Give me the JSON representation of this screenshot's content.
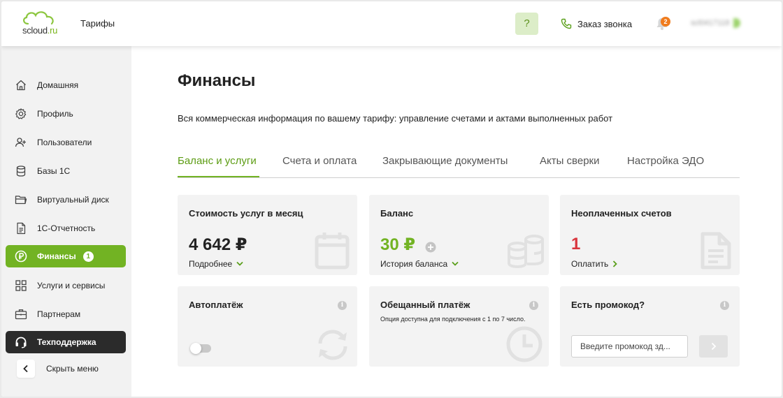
{
  "header": {
    "logo": {
      "name": "scloud",
      "tld": ".ru"
    },
    "tariffs_link": "Тарифы",
    "help_label": "?",
    "callback_label": "Заказ звонка",
    "notifications_count": "2",
    "account_label": "scl0417118"
  },
  "sidebar": {
    "items": [
      {
        "label": "Домашняя",
        "icon": "home-icon"
      },
      {
        "label": "Профиль",
        "icon": "gear-icon"
      },
      {
        "label": "Пользователи",
        "icon": "add-user-icon"
      },
      {
        "label": "Базы 1С",
        "icon": "database-icon"
      },
      {
        "label": "Виртуальный диск",
        "icon": "folder-icon"
      },
      {
        "label": "1С-Отчетность",
        "icon": "document-icon"
      },
      {
        "label": "Финансы",
        "icon": "ruble-icon",
        "badge": "1",
        "active": true
      },
      {
        "label": "Услуги и сервисы",
        "icon": "grid-icon"
      },
      {
        "label": "Партнерам",
        "icon": "briefcase-icon"
      },
      {
        "label": "Техподдержка",
        "icon": "headset-icon"
      }
    ],
    "hide_menu": "Скрыть меню"
  },
  "main": {
    "title": "Финансы",
    "description": "Вся коммерческая информация по вашему тарифу: управление счетами и актами выполненных работ",
    "tabs": [
      {
        "label": "Баланс и услуги",
        "active": true
      },
      {
        "label": "Счета и оплата"
      },
      {
        "label": "Закрывающие документы"
      },
      {
        "label": "Акты сверки"
      },
      {
        "label": "Настройка ЭДО"
      }
    ],
    "cards": {
      "monthly": {
        "title": "Стоимость услуг в месяц",
        "value": "4 642 ₽",
        "link": "Подробнее"
      },
      "balance": {
        "title": "Баланс",
        "value": "30 ₽",
        "link": "История баланса"
      },
      "unpaid": {
        "title": "Неоплаченных счетов",
        "value": "1",
        "link": "Оплатить"
      },
      "autopay": {
        "title": "Автоплатёж"
      },
      "promised": {
        "title": "Обещанный платёж",
        "note": "Опция доступна для подключения с 1 по 7 число."
      },
      "promo": {
        "title": "Есть промокод?",
        "placeholder": "Введите промокод зд..."
      }
    }
  },
  "colors": {
    "accent": "#72b323",
    "danger": "#d9363e",
    "support": "#2b2b2b",
    "badge": "#f07c1e"
  }
}
